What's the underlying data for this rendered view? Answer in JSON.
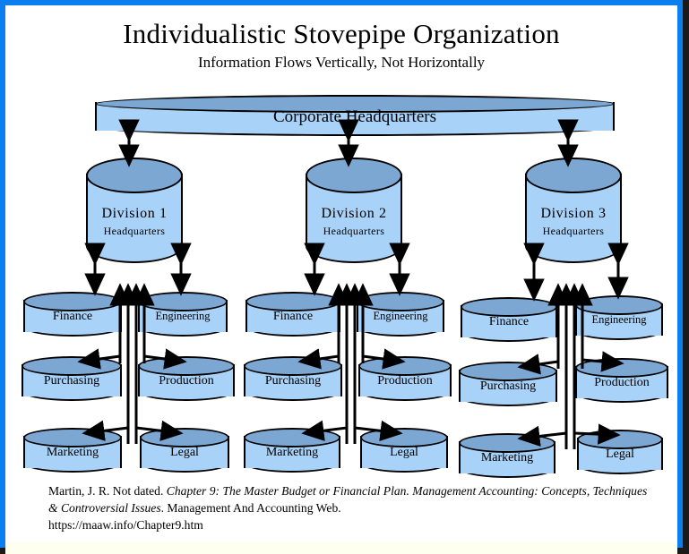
{
  "document": {
    "title": "Individualistic Stovepipe Organization",
    "subtitle": "Information Flows Vertically, Not Horizontally"
  },
  "colors": {
    "frame_outer": "#1a1a1a",
    "frame_blue": "#0b7ff0",
    "canvas": "#ffffff",
    "cylinder_body": "#a8d2f8",
    "cylinder_top": "#7ca7d2",
    "outline": "#000000",
    "bottom_strip": "#fffff0"
  },
  "headquarters": {
    "label": "Corporate Headquarters"
  },
  "divisions": [
    {
      "name": "Division 1",
      "subtitle": "Headquarters",
      "departments": {
        "left_top": "Finance",
        "right_top": "Engineering",
        "left_mid": "Purchasing",
        "right_mid": "Production",
        "left_bottom": "Marketing",
        "right_bottom": "Legal"
      }
    },
    {
      "name": "Division 2",
      "subtitle": "Headquarters",
      "departments": {
        "left_top": "Finance",
        "right_top": "Engineering",
        "left_mid": "Purchasing",
        "right_mid": "Production",
        "left_bottom": "Marketing",
        "right_bottom": "Legal"
      }
    },
    {
      "name": "Division 3",
      "subtitle": "Headquarters",
      "departments": {
        "left_top": "Finance",
        "right_top": "Engineering",
        "left_mid": "Purchasing",
        "right_mid": "Production",
        "left_bottom": "Marketing",
        "right_bottom": "Legal"
      }
    }
  ],
  "citation": {
    "author": "Martin, J. R. Not dated.",
    "chapter_italic": "Chapter 9: The Master Budget or Financial Plan. Management Accounting: Concepts, Techniques & Controversial Issues",
    "publisher": ". Management And Accounting Web.",
    "url": "https://maaw.info/Chapter9.htm"
  }
}
